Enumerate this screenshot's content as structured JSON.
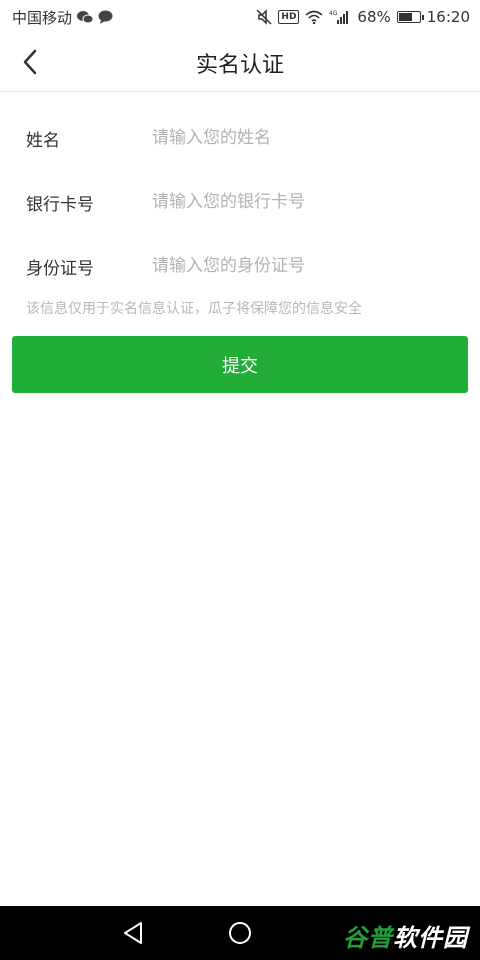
{
  "status_bar": {
    "carrier": "中国移动",
    "battery_percent": "68%",
    "battery_level": 0.68,
    "time": "16:20",
    "network": "4G",
    "hd_badge": "HD",
    "icons": [
      "wechat-icon",
      "chat-bubble-icon",
      "mute-icon",
      "hd-icon",
      "wifi-icon",
      "signal-icon",
      "battery-icon"
    ]
  },
  "nav": {
    "title": "实名认证",
    "back_icon": "chevron-left-icon"
  },
  "form": {
    "fields": [
      {
        "label": "姓名",
        "placeholder": "请输入您的姓名",
        "value": ""
      },
      {
        "label": "银行卡号",
        "placeholder": "请输入您的银行卡号",
        "value": ""
      },
      {
        "label": "身份证号",
        "placeholder": "请输入您的身份证号",
        "value": ""
      }
    ],
    "hint": "该信息仅用于实名信息认证，瓜子将保障您的信息安全",
    "submit_label": "提交"
  },
  "system_nav": {
    "buttons": [
      "back-triangle-icon",
      "home-circle-icon"
    ]
  },
  "watermark": {
    "text_a": "谷普",
    "text_b": "软件园"
  },
  "colors": {
    "accent": "#22ac38",
    "placeholder": "#b2b2b2",
    "hint": "#b8b8b8"
  }
}
